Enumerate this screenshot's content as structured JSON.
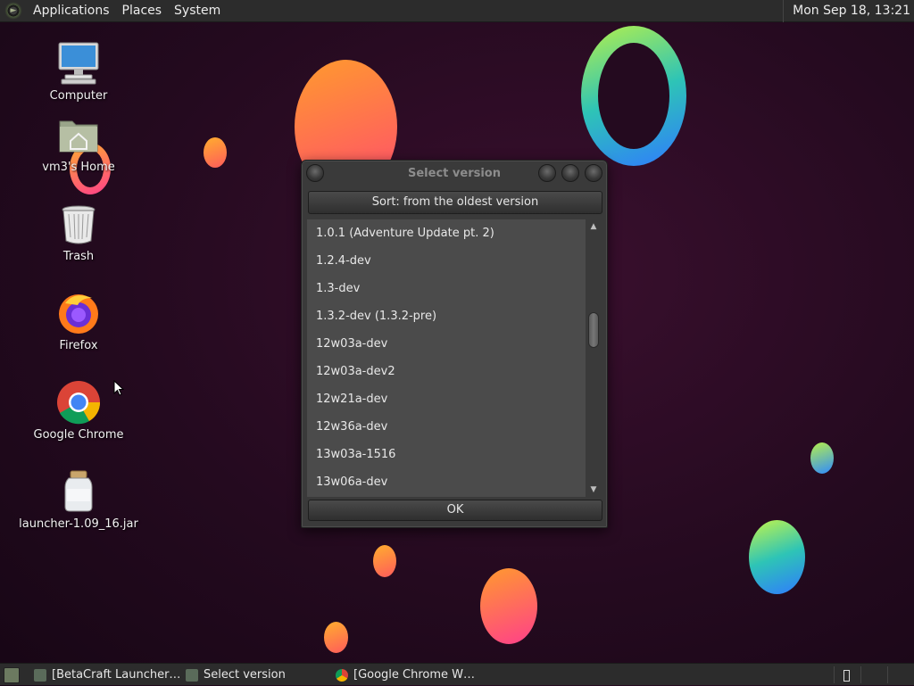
{
  "top_panel": {
    "menus": [
      "Applications",
      "Places",
      "System"
    ],
    "clock": "Mon Sep 18, 13:21"
  },
  "desktop_icons": [
    {
      "label": "Computer",
      "icon": "computer-icon"
    },
    {
      "label": "vm3's Home",
      "icon": "home-folder-icon"
    },
    {
      "label": "Trash",
      "icon": "trash-icon"
    },
    {
      "label": "Firefox",
      "icon": "firefox-icon"
    },
    {
      "label": "Google Chrome",
      "icon": "chrome-icon"
    },
    {
      "label": "launcher-1.09_16.jar",
      "icon": "jar-icon"
    }
  ],
  "dialog": {
    "title": "Select version",
    "sort_button": "Sort: from the oldest version",
    "versions": [
      "1.0.1 (Adventure Update pt. 2)",
      "1.2.4-dev",
      "1.3-dev",
      "1.3.2-dev (1.3.2-pre)",
      "12w03a-dev",
      "12w03a-dev2",
      "12w21a-dev",
      "12w36a-dev",
      "13w03a-1516",
      "13w06a-dev"
    ],
    "ok_button": "OK"
  },
  "taskbar": {
    "tasks": [
      {
        "label": "[BetaCraft Launcher…",
        "icon": "java-icon"
      },
      {
        "label": "Select version",
        "icon": "java-icon"
      },
      {
        "label": "[Google Chrome W…",
        "icon": "chrome-icon"
      }
    ]
  },
  "colors": {
    "panel": "#2c2c2c",
    "desktop_bg": "#240a1f",
    "dialog_bg": "#3a3a3a",
    "list_bg": "#4b4b4b"
  }
}
